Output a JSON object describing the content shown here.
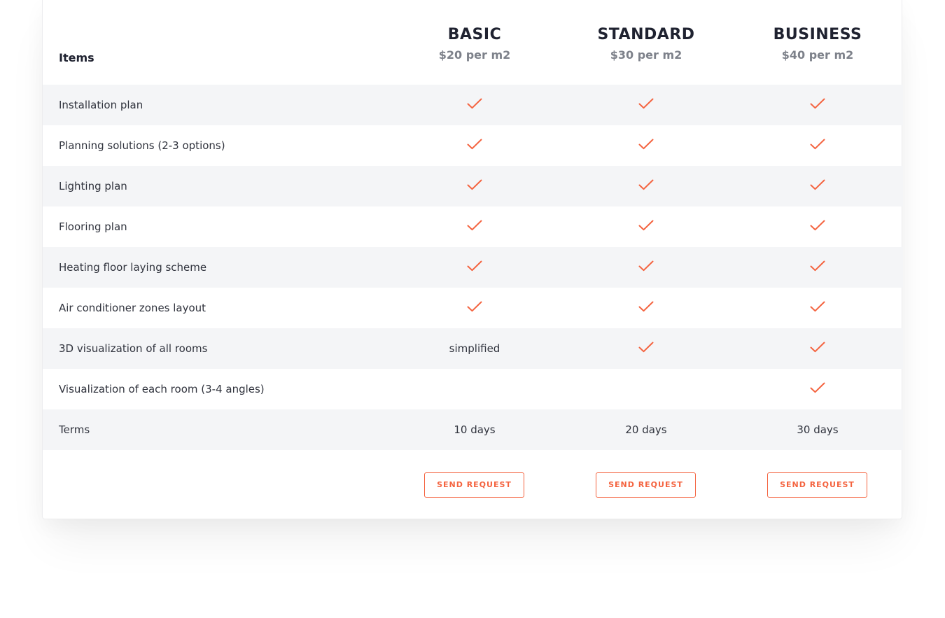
{
  "table": {
    "items_header": "Items",
    "accent_color": "#f4633f",
    "plans": [
      {
        "name": "BASIC",
        "price": "$20 per m2",
        "button_label": "SEND REQUEST"
      },
      {
        "name": "STANDARD",
        "price": "$30 per m2",
        "button_label": "SEND REQUEST"
      },
      {
        "name": "BUSINESS",
        "price": "$40 per m2",
        "button_label": "SEND REQUEST"
      }
    ],
    "rows": [
      {
        "label": "Installation plan",
        "cells": [
          {
            "type": "check-icon"
          },
          {
            "type": "check-icon"
          },
          {
            "type": "check-icon"
          }
        ]
      },
      {
        "label": "Planning solutions (2-3 options)",
        "cells": [
          {
            "type": "check-icon"
          },
          {
            "type": "check-icon"
          },
          {
            "type": "check-icon"
          }
        ]
      },
      {
        "label": "Lighting plan",
        "cells": [
          {
            "type": "check-icon"
          },
          {
            "type": "check-icon"
          },
          {
            "type": "check-icon"
          }
        ]
      },
      {
        "label": "Flooring plan",
        "cells": [
          {
            "type": "check-icon"
          },
          {
            "type": "check-icon"
          },
          {
            "type": "check-icon"
          }
        ]
      },
      {
        "label": "Heating floor laying scheme",
        "cells": [
          {
            "type": "check-icon"
          },
          {
            "type": "check-icon"
          },
          {
            "type": "check-icon"
          }
        ]
      },
      {
        "label": "Air conditioner zones layout",
        "cells": [
          {
            "type": "check-icon"
          },
          {
            "type": "check-icon"
          },
          {
            "type": "check-icon"
          }
        ]
      },
      {
        "label": "3D visualization of all rooms",
        "cells": [
          {
            "type": "text",
            "text": "simplified"
          },
          {
            "type": "check-icon"
          },
          {
            "type": "check-icon"
          }
        ]
      },
      {
        "label": "Visualization of each room (3-4 angles)",
        "cells": [
          {
            "type": "empty"
          },
          {
            "type": "empty"
          },
          {
            "type": "check-icon"
          }
        ]
      },
      {
        "label": "Terms",
        "cells": [
          {
            "type": "text",
            "text": "10 days"
          },
          {
            "type": "text",
            "text": "20 days"
          },
          {
            "type": "text",
            "text": "30 days"
          }
        ]
      }
    ]
  }
}
